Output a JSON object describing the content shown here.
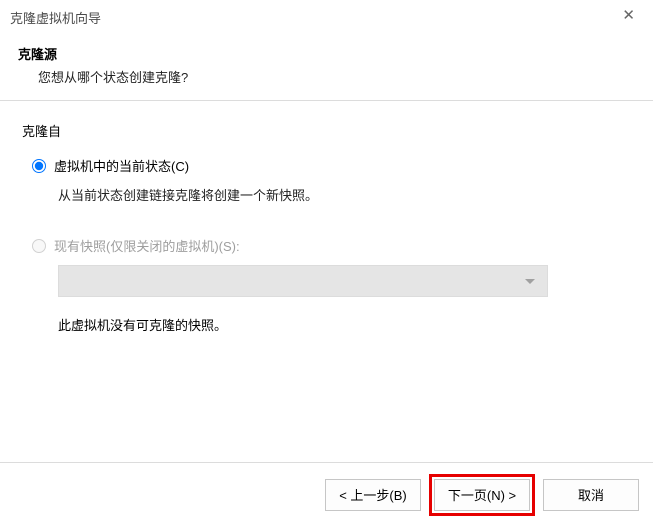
{
  "window": {
    "title": "克隆虚拟机向导"
  },
  "header": {
    "title": "克隆源",
    "subtitle": "您想从哪个状态创建克隆?"
  },
  "body": {
    "section_title": "克隆自",
    "option1_label": "虚拟机中的当前状态(C)",
    "option1_hint": "从当前状态创建链接克隆将创建一个新快照。",
    "option2_label": "现有快照(仅限关闭的虚拟机)(S):",
    "no_snapshot_text": "此虚拟机没有可克隆的快照。"
  },
  "footer": {
    "back_label": "< 上一步(B)",
    "next_label": "下一页(N) >",
    "cancel_label": "取消"
  }
}
